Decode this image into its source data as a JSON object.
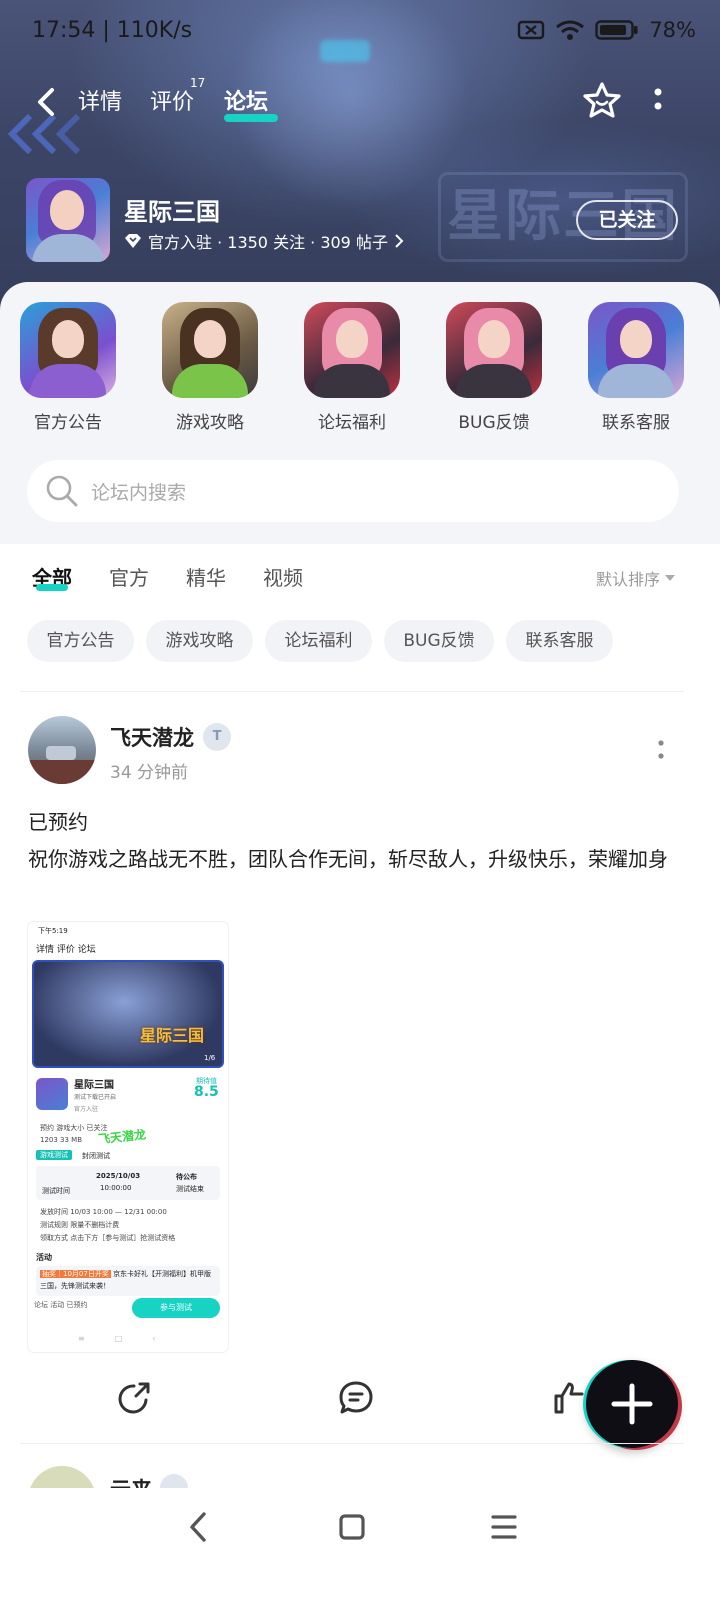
{
  "status_bar": {
    "time_speed": "17:54 | 110K/s",
    "battery": "78%",
    "icons": [
      "sim-off-icon",
      "wifi-icon",
      "battery-icon"
    ]
  },
  "nav": {
    "tabs": [
      {
        "label": "详情",
        "active": false
      },
      {
        "label": "评价",
        "active": false,
        "count": "17"
      },
      {
        "label": "论坛",
        "active": true
      }
    ]
  },
  "forum": {
    "name": "星际三国",
    "meta": "官方入驻 · 1350 关注 · 309 帖子",
    "follow_label": "已关注",
    "watermark": "星际三国"
  },
  "categories": [
    {
      "label": "官方公告"
    },
    {
      "label": "游戏攻略"
    },
    {
      "label": "论坛福利"
    },
    {
      "label": "BUG反馈"
    },
    {
      "label": "联系客服"
    }
  ],
  "search": {
    "placeholder": "论坛内搜索"
  },
  "filter": {
    "tabs": [
      {
        "label": "全部",
        "active": true
      },
      {
        "label": "官方",
        "active": false
      },
      {
        "label": "精华",
        "active": false
      },
      {
        "label": "视频",
        "active": false
      }
    ],
    "sort_label": "默认排序",
    "chips": [
      "官方公告",
      "游戏攻略",
      "论坛福利",
      "BUG反馈",
      "联系客服"
    ]
  },
  "post": {
    "user": "飞天潜龙",
    "badge": "T",
    "time": "34 分钟前",
    "line1": "已预约",
    "line2": "祝你游戏之路战无不胜，团队合作无间，斩尽敌人，升级快乐，荣耀加身",
    "screenshot": {
      "status": "下午5:19",
      "nav": "详情   评价   论坛",
      "game": "星际三国",
      "sub1": "测试下载已开启",
      "sub2": "官方入驻",
      "score_label": "期待值",
      "score": "8.5",
      "stats1": "预约       游戏大小       已关注",
      "stats2": "1203       33 MB",
      "watermark": "飞天潜龙",
      "tag": "游戏测试",
      "tag2": "封闭测试",
      "date_label": "测试时间",
      "date": "2025/10/03",
      "date_sub": "10:00:00",
      "date_end": "待公布",
      "date_end_sub": "测试结束",
      "line_a": "发放时间   10/03 10:00 — 12/31 00:00",
      "line_b": "测试规则   限量不删档计费",
      "line_c": "领取方式   点击下方［参与测试］抢测试资格",
      "activity": "活动",
      "promo_tag": "抽奖｜10月07日开奖",
      "promo": "京东卡好礼【开测福利】机甲版三国，先锋测试来袭！",
      "bottom": "论坛   活动        已预约",
      "cta": "参与测试",
      "page": "1/6"
    }
  },
  "next_post": {
    "user": "云来"
  }
}
